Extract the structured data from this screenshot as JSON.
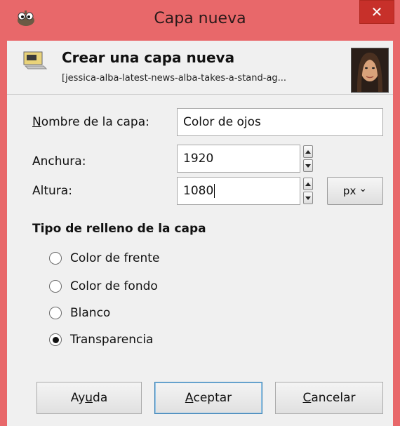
{
  "window": {
    "title": "Capa nueva",
    "close_glyph": "✕"
  },
  "header": {
    "title": "Crear una capa nueva",
    "subtitle": "[jessica-alba-latest-news-alba-takes-a-stand-ag..."
  },
  "form": {
    "name_label_mnemonic": "N",
    "name_label_rest": "ombre de la capa:",
    "name_value": "Color de ojos",
    "width_label": "Anchura:",
    "width_value": "1920",
    "height_label": "Altura:",
    "height_value": "1080",
    "unit_value": "px",
    "unit_chevron": "⌄"
  },
  "fill": {
    "title": "Tipo de relleno de la capa",
    "options": [
      {
        "label": "Color de frente",
        "selected": false
      },
      {
        "label": "Color de fondo",
        "selected": false
      },
      {
        "label": "Blanco",
        "selected": false
      },
      {
        "label": "Transparencia",
        "selected": true
      }
    ]
  },
  "buttons": {
    "help_pre": "Ay",
    "help_mn": "u",
    "help_post": "da",
    "ok_mn": "A",
    "ok_post": "ceptar",
    "cancel_mn": "C",
    "cancel_post": "ancelar"
  },
  "icons": {
    "app": "gimp-wilber-icon",
    "header": "new-layer-icon",
    "thumb": "image-thumbnail",
    "spin_up": "spin-up-icon",
    "spin_down": "spin-down-icon"
  },
  "colors": {
    "titlebar": "#e8686a",
    "close": "#c7302a",
    "client": "#f0f0f0",
    "default_button_border": "#3c7fb1"
  }
}
